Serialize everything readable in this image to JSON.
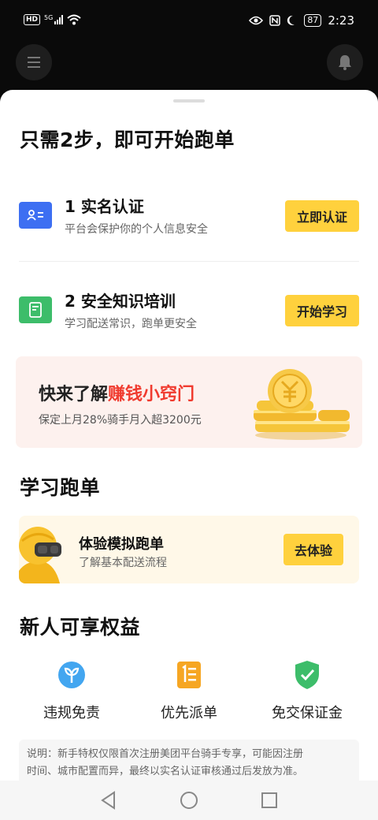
{
  "status_bar": {
    "network_badge": "HD",
    "signal_label": "5G",
    "battery": "87",
    "time": "2:23"
  },
  "header": {
    "menu_icon": "menu-icon",
    "bell_icon": "bell-icon"
  },
  "onboarding": {
    "title": "只需2步，即可开始跑单",
    "steps": [
      {
        "title": "1 实名认证",
        "subtitle": "平台会保护你的个人信息安全",
        "button": "立即认证",
        "icon": "id-card-icon",
        "icon_color": "#3d6ff2"
      },
      {
        "title": "2 安全知识培训",
        "subtitle": "学习配送常识，跑单更安全",
        "button": "开始学习",
        "icon": "document-icon",
        "icon_color": "#3dbd6a"
      }
    ]
  },
  "promo": {
    "title_prefix": "快来了解",
    "title_highlight": "赚钱小窍门",
    "subtitle": "保定上月28%骑手月入超3200元",
    "highlight_color": "#f03b2f"
  },
  "learn": {
    "heading": "学习跑单",
    "card_title": "体验模拟跑单",
    "card_subtitle": "了解基本配送流程",
    "button": "去体验"
  },
  "benefits": {
    "heading": "新人可享权益",
    "items": [
      {
        "label": "违规免责",
        "icon": "sprout-icon"
      },
      {
        "label": "优先派单",
        "icon": "list-icon"
      },
      {
        "label": "免交保证金",
        "icon": "shield-check-icon"
      }
    ],
    "note_line1": "说明：新手特权仅限首次注册美团平台骑手专享，可能因注册",
    "note_line2": "时间、城市配置而异，最终以实名认证审核通过后发放为准。"
  },
  "colors": {
    "accent_yellow": "#ffd13d",
    "background_dark": "#0a0a0a"
  }
}
